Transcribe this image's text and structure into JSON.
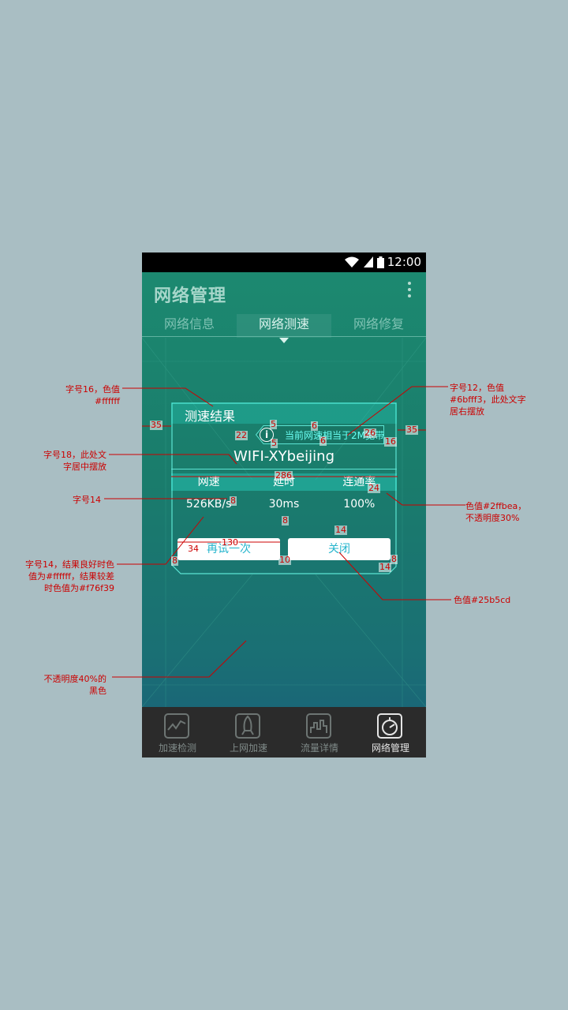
{
  "status_bar": {
    "time": "12:00"
  },
  "app": {
    "title": "网络管理"
  },
  "tabs": [
    {
      "label": "网络信息"
    },
    {
      "label": "网络测速"
    },
    {
      "label": "网络修复"
    }
  ],
  "card": {
    "title": "测速结果",
    "info_text": "当前网速相当于2M宽带",
    "ssid": "WIFI-XYbeijing",
    "metrics": {
      "headers": [
        "网速",
        "延时",
        "连通率"
      ],
      "values": [
        "526KB/s",
        "30ms",
        "100%"
      ]
    },
    "buttons": {
      "retry": "再试一次",
      "close": "关闭"
    }
  },
  "bottom_nav": [
    {
      "label": "加速检测",
      "icon": "speed-chart-icon"
    },
    {
      "label": "上网加速",
      "icon": "rocket-icon"
    },
    {
      "label": "流量详情",
      "icon": "bar-chart-icon"
    },
    {
      "label": "网络管理",
      "icon": "network-manage-icon"
    }
  ],
  "annotations": {
    "title_font": "字号16，色值\n#ffffff",
    "info_font": "字号12，色值\n#6bfff3，此处文字\n居右摆放",
    "ssid_font": "字号18，此处文\n字居中摆放",
    "metric_font": "字号14",
    "header_color": "色值#2ffbea，\n不透明度30%",
    "result_font": "字号14，结果良好时色\n值为#ffffff，结果较差\n时色值为#f76f39",
    "button_color": "色值#25b5cd",
    "overlay": "不透明度40%的\n黑色"
  },
  "dimensions": {
    "d35_left": "35",
    "d35_right": "35",
    "d5a": "5",
    "d6a": "6",
    "d22": "22",
    "d26": "26",
    "d6b": "6",
    "d5b": "5",
    "d16": "16",
    "d286": "286",
    "d24": "24",
    "d8a": "8",
    "d8b": "8",
    "d14a": "14",
    "d130": "130",
    "d34": "34",
    "d8c": "8",
    "d10": "10",
    "d8d": "8",
    "d14b": "14"
  },
  "colors": {
    "title": "#ffffff",
    "info_text": "#6bfff3",
    "header_band": "#2ffbea",
    "button_text": "#25b5cd",
    "result_bad": "#f76f39",
    "annotation": "#cc0000"
  }
}
